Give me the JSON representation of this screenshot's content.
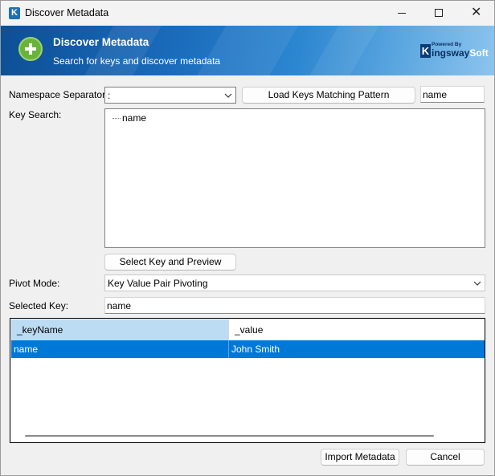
{
  "window": {
    "title": "Discover Metadata",
    "app_icon_letter": "K"
  },
  "banner": {
    "title": "Discover Metadata",
    "subtitle": "Search for keys and discover metadata",
    "logo": {
      "powered_by": "Powered By",
      "brand_part1": "ingsway",
      "brand_part2": "Soft",
      "brand_letter": "K"
    }
  },
  "form": {
    "namespace_separator": {
      "label": "Namespace Separator:",
      "value": ":"
    },
    "load_keys_button": "Load Keys Matching Pattern",
    "pattern_value": "name",
    "key_search": {
      "label": "Key Search:",
      "nodes": [
        "name"
      ]
    },
    "select_key_button": "Select Key and Preview",
    "pivot_mode": {
      "label": "Pivot Mode:",
      "value": "Key Value Pair Pivoting"
    },
    "selected_key": {
      "label": "Selected Key:",
      "value": "name"
    }
  },
  "grid": {
    "columns": [
      "_keyName",
      "_value"
    ],
    "rows": [
      {
        "keyName": "name",
        "value": "John Smith"
      }
    ]
  },
  "footer": {
    "import_button": "Import Metadata",
    "cancel_button": "Cancel"
  },
  "colors": {
    "accent": "#0078d7",
    "banner": "#1a6bbb",
    "header_selected": "#bcdcf4",
    "plus_green": "#6ab33a"
  }
}
